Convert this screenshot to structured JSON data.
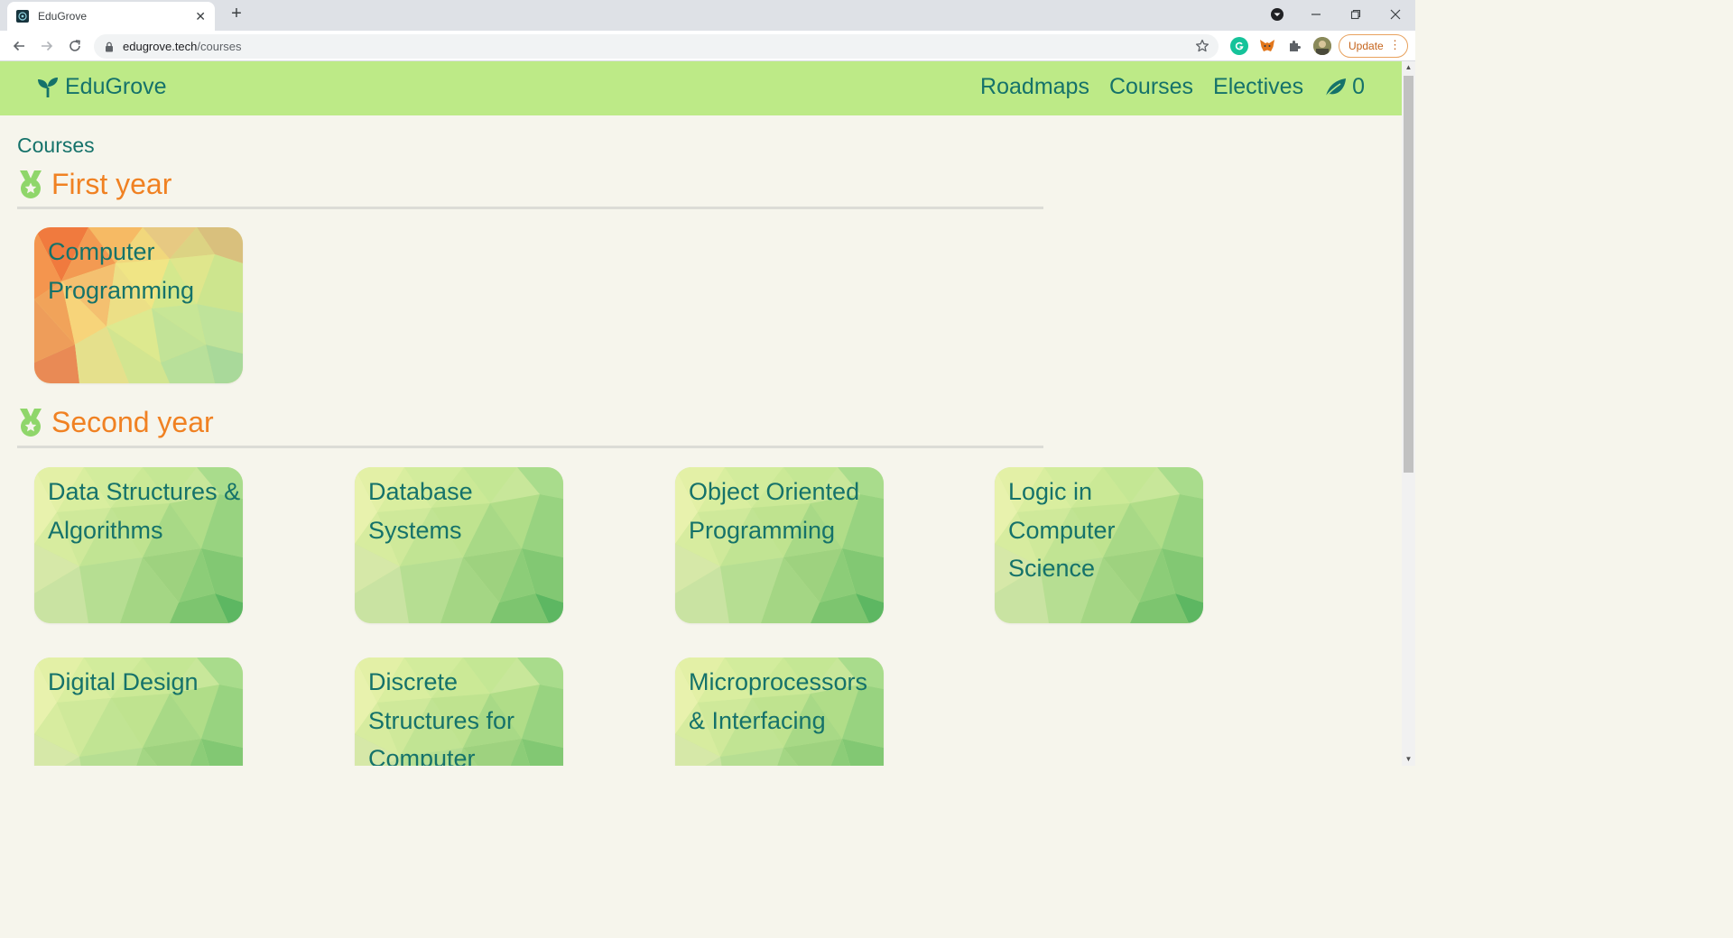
{
  "browser": {
    "tab_title": "EduGrove",
    "url_host": "edugrove.tech",
    "url_path": "/courses",
    "update_label": "Update"
  },
  "site": {
    "brand": "EduGrove",
    "nav": [
      "Roadmaps",
      "Courses",
      "Electives"
    ],
    "leaf_count": "0"
  },
  "page": {
    "heading": "Courses",
    "sections": [
      {
        "title": "First year",
        "courses": [
          {
            "label": "Computer Programming",
            "theme": "warm"
          }
        ]
      },
      {
        "title": "Second year",
        "courses": [
          {
            "label": "Data Structures & Algorithms",
            "theme": "green"
          },
          {
            "label": "Database Systems",
            "theme": "green"
          },
          {
            "label": "Object Oriented Programming",
            "theme": "green"
          },
          {
            "label": "Logic in Computer Science",
            "theme": "green"
          },
          {
            "label": "Digital Design",
            "theme": "green"
          },
          {
            "label": "Discrete Structures for Computer",
            "theme": "green"
          },
          {
            "label": "Microprocessors & Interfacing",
            "theme": "green"
          }
        ]
      }
    ]
  },
  "colors": {
    "nav_bg": "#bdea87",
    "brand_teal": "#15726a",
    "section_orange": "#f08122",
    "page_bg": "#f6f5ec"
  }
}
